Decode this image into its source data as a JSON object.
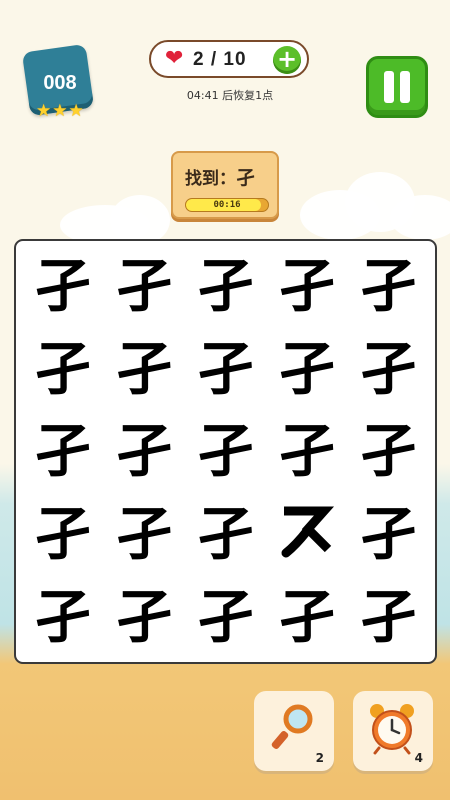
{
  "level": {
    "number": "008",
    "stars": [
      "★",
      "★",
      "★"
    ]
  },
  "lives": {
    "text": "2 / 10",
    "heart_icon": "heart-icon",
    "plus_icon": "plus-icon"
  },
  "recover": {
    "text": "04:41 后恢复1点"
  },
  "target": {
    "label": "找到：",
    "char": "孑",
    "timer": "00:16",
    "timer_progress": 0.92
  },
  "board": {
    "cells": [
      "孑",
      "孑",
      "孑",
      "孑",
      "孑",
      "孑",
      "孑",
      "孑",
      "孑",
      "孑",
      "孑",
      "孑",
      "孑",
      "孑",
      "孑",
      "孑",
      "孑",
      "孑",
      "",
      "孑",
      "孑",
      "孑",
      "孑",
      "孑",
      "孑"
    ]
  },
  "tools": [
    {
      "name": "magnifier-tool",
      "icon": "magnifier-icon",
      "count": "2"
    },
    {
      "name": "alarm-clock-tool",
      "icon": "alarm-clock-icon",
      "count": "4"
    }
  ],
  "colors": {
    "accent_green": "#4dbb28",
    "heart_red": "#e0223a",
    "badge_blue": "#2f7f97"
  }
}
